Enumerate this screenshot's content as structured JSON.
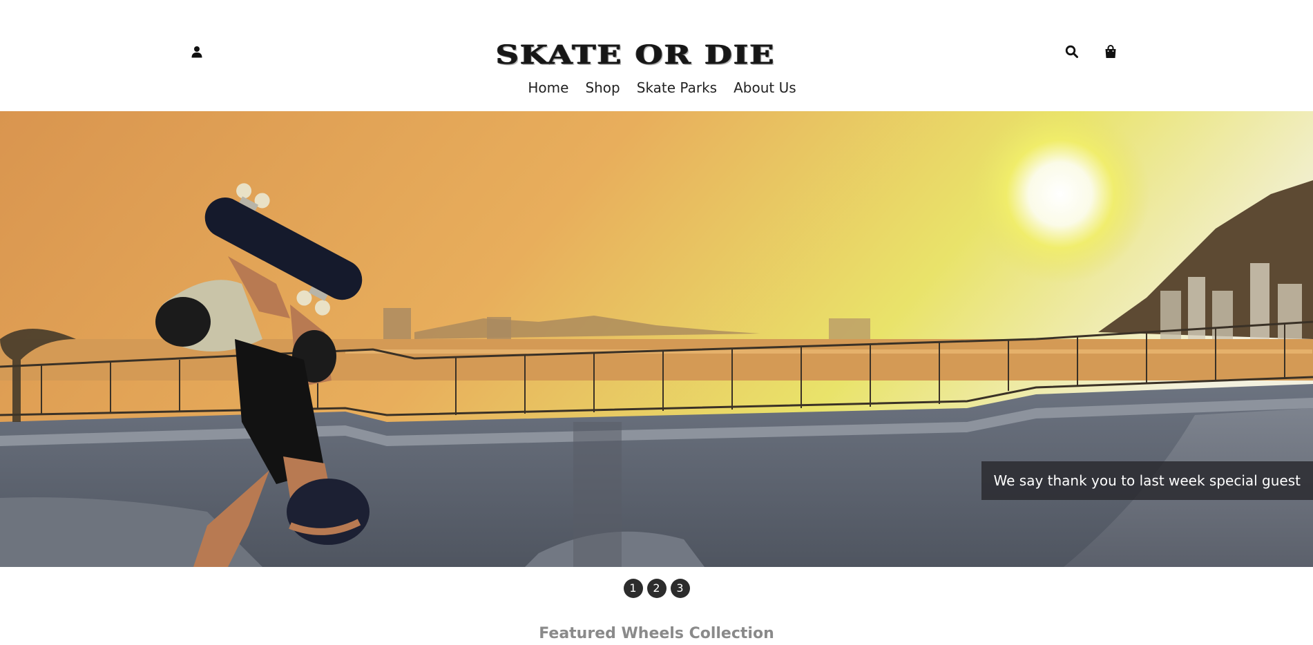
{
  "header": {
    "logo_text": "SKATE OR DIE",
    "icons": {
      "account": "user-icon",
      "search": "search-icon",
      "cart": "shopping-bag-icon"
    }
  },
  "nav": {
    "items": [
      {
        "label": "Home"
      },
      {
        "label": "Shop"
      },
      {
        "label": "Skate Parks"
      },
      {
        "label": "About Us"
      }
    ]
  },
  "hero": {
    "caption": "We say thank you to last week special guest"
  },
  "slider": {
    "dots": [
      {
        "label": "1"
      },
      {
        "label": "2"
      },
      {
        "label": "3"
      }
    ]
  },
  "featured": {
    "title": "Featured Wheels Collection"
  },
  "colors": {
    "text_dark": "#1a1a1a",
    "caption_bg": "#28282d",
    "dot_bg": "#2c2c2c",
    "section_title": "#8a8a8a"
  }
}
